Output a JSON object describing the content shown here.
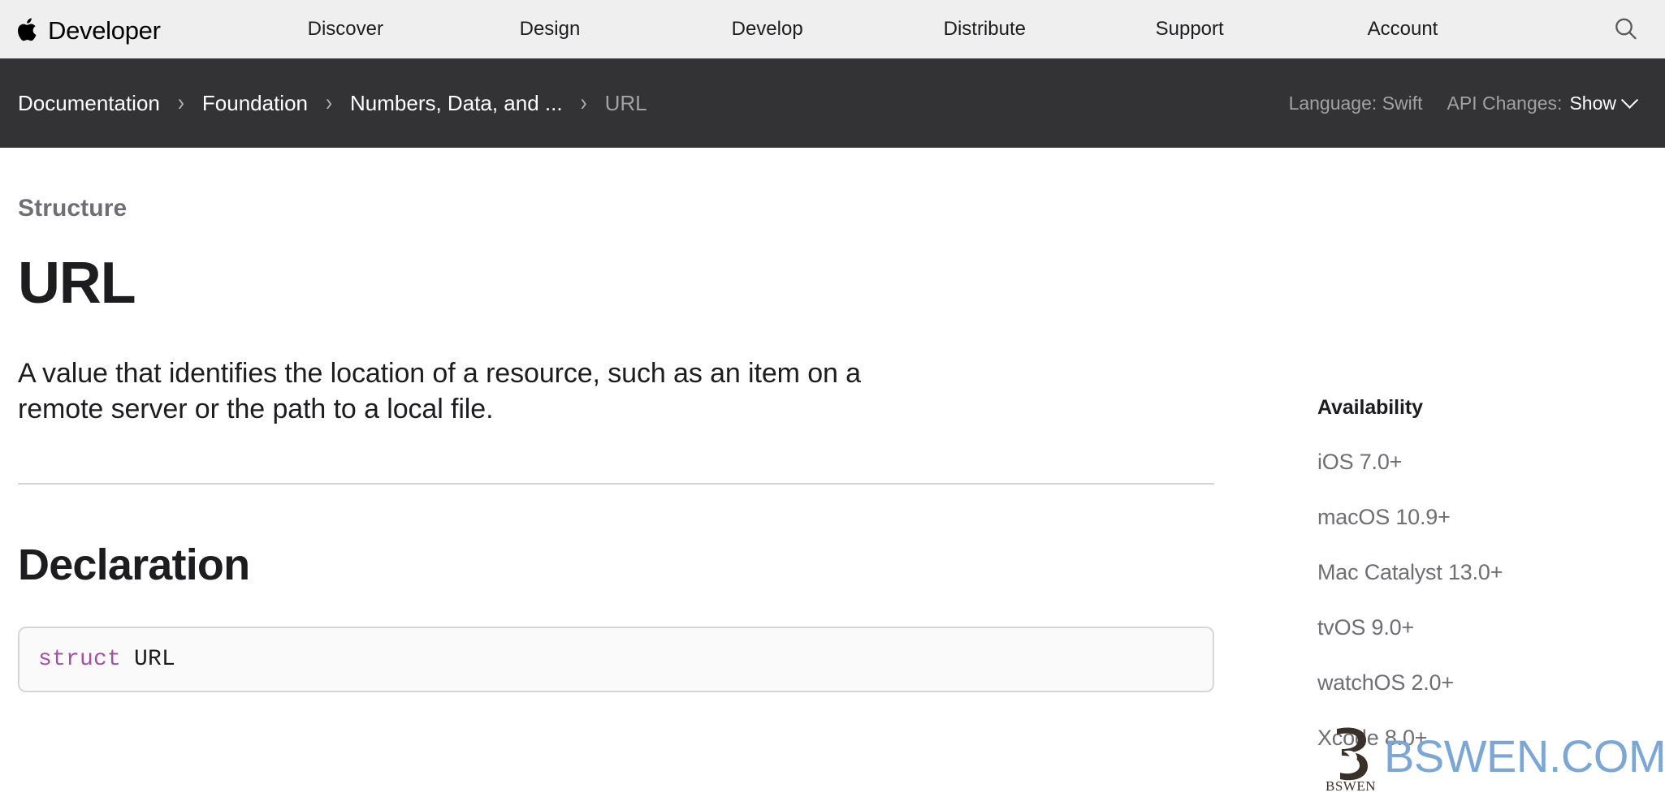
{
  "globalnav": {
    "brand": "Developer",
    "apple_icon": "apple-logo-icon",
    "links": [
      {
        "label": "Discover"
      },
      {
        "label": "Design"
      },
      {
        "label": "Develop"
      },
      {
        "label": "Distribute"
      },
      {
        "label": "Support"
      },
      {
        "label": "Account"
      }
    ],
    "search_icon": "search-icon"
  },
  "docbar": {
    "breadcrumbs": [
      {
        "label": "Documentation",
        "current": false
      },
      {
        "label": "Foundation",
        "current": false
      },
      {
        "label": "Numbers, Data, and ...",
        "current": false
      },
      {
        "label": "URL",
        "current": true
      }
    ],
    "separator": "›",
    "language_label": "Language:",
    "language_value": "Swift",
    "api_changes_label": "API Changes:",
    "api_changes_value": "Show",
    "chevron_icon": "chevron-down-icon"
  },
  "main": {
    "eyebrow": "Structure",
    "title": "URL",
    "abstract": "A value that identifies the location of a resource, such as an item on a remote server or the path to a local file.",
    "declaration_heading": "Declaration",
    "declaration_keyword": "struct",
    "declaration_identifier": "URL"
  },
  "aside": {
    "title": "Availability",
    "items": [
      {
        "label": "iOS 7.0+"
      },
      {
        "label": "macOS 10.9+"
      },
      {
        "label": "Mac Catalyst 13.0+"
      },
      {
        "label": "tvOS 9.0+"
      },
      {
        "label": "watchOS 2.0+"
      },
      {
        "label": "Xcode 8.0+"
      }
    ]
  },
  "watermark": {
    "text": "BSWEN.COM",
    "logo_caption": "BSWEN",
    "color": "#7ba7d7"
  },
  "colors": {
    "globalnav_bg": "#efeff0",
    "docbar_bg": "#333336",
    "text_primary": "#1d1d1f",
    "text_secondary": "#6e6e73",
    "keyword_purple": "#a550a7",
    "rule": "#d2d2d7"
  }
}
